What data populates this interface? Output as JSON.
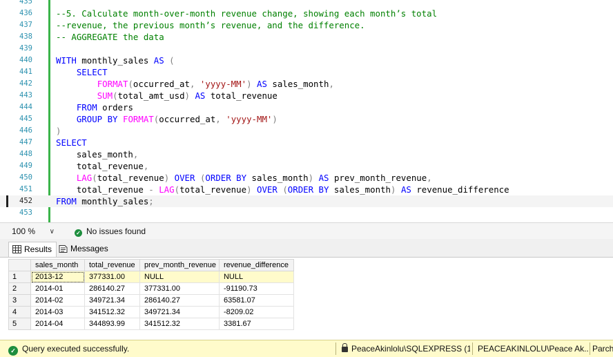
{
  "editor": {
    "lines": [
      {
        "n": "435",
        "tokens": []
      },
      {
        "n": "436",
        "tokens": [
          {
            "t": "c",
            "v": "--5. Calculate month-over-month revenue change, showing each month’s total"
          }
        ]
      },
      {
        "n": "437",
        "tokens": [
          {
            "t": "c",
            "v": "--revenue, the previous month’s revenue, and the difference."
          }
        ]
      },
      {
        "n": "438",
        "tokens": [
          {
            "t": "c",
            "v": "-- AGGREGATE the data"
          }
        ]
      },
      {
        "n": "439",
        "tokens": []
      },
      {
        "n": "440",
        "tokens": [
          {
            "t": "k",
            "v": "WITH"
          },
          {
            "t": "p",
            "v": " monthly_sales "
          },
          {
            "t": "k",
            "v": "AS"
          },
          {
            "t": "o",
            "v": " ("
          }
        ]
      },
      {
        "n": "441",
        "tokens": [
          {
            "t": "p",
            "v": "    "
          },
          {
            "t": "k",
            "v": "SELECT"
          }
        ]
      },
      {
        "n": "442",
        "tokens": [
          {
            "t": "p",
            "v": "        "
          },
          {
            "t": "f",
            "v": "FORMAT"
          },
          {
            "t": "o",
            "v": "("
          },
          {
            "t": "p",
            "v": "occurred_at"
          },
          {
            "t": "o",
            "v": ","
          },
          {
            "t": "p",
            "v": " "
          },
          {
            "t": "s",
            "v": "'yyyy-MM'"
          },
          {
            "t": "o",
            "v": ")"
          },
          {
            "t": "p",
            "v": " "
          },
          {
            "t": "k",
            "v": "AS"
          },
          {
            "t": "p",
            "v": " sales_month"
          },
          {
            "t": "o",
            "v": ","
          }
        ]
      },
      {
        "n": "443",
        "tokens": [
          {
            "t": "p",
            "v": "        "
          },
          {
            "t": "f",
            "v": "SUM"
          },
          {
            "t": "o",
            "v": "("
          },
          {
            "t": "p",
            "v": "total_amt_usd"
          },
          {
            "t": "o",
            "v": ")"
          },
          {
            "t": "p",
            "v": " "
          },
          {
            "t": "k",
            "v": "AS"
          },
          {
            "t": "p",
            "v": " total_revenue"
          }
        ]
      },
      {
        "n": "444",
        "tokens": [
          {
            "t": "p",
            "v": "    "
          },
          {
            "t": "k",
            "v": "FROM"
          },
          {
            "t": "p",
            "v": " orders"
          }
        ]
      },
      {
        "n": "445",
        "tokens": [
          {
            "t": "p",
            "v": "    "
          },
          {
            "t": "k",
            "v": "GROUP BY"
          },
          {
            "t": "p",
            "v": " "
          },
          {
            "t": "f",
            "v": "FORMAT"
          },
          {
            "t": "o",
            "v": "("
          },
          {
            "t": "p",
            "v": "occurred_at"
          },
          {
            "t": "o",
            "v": ","
          },
          {
            "t": "p",
            "v": " "
          },
          {
            "t": "s",
            "v": "'yyyy-MM'"
          },
          {
            "t": "o",
            "v": ")"
          }
        ]
      },
      {
        "n": "446",
        "tokens": [
          {
            "t": "o",
            "v": ")"
          }
        ]
      },
      {
        "n": "447",
        "tokens": [
          {
            "t": "k",
            "v": "SELECT"
          }
        ]
      },
      {
        "n": "448",
        "tokens": [
          {
            "t": "p",
            "v": "    sales_month"
          },
          {
            "t": "o",
            "v": ","
          }
        ]
      },
      {
        "n": "449",
        "tokens": [
          {
            "t": "p",
            "v": "    total_revenue"
          },
          {
            "t": "o",
            "v": ","
          }
        ]
      },
      {
        "n": "450",
        "tokens": [
          {
            "t": "p",
            "v": "    "
          },
          {
            "t": "f",
            "v": "LAG"
          },
          {
            "t": "o",
            "v": "("
          },
          {
            "t": "p",
            "v": "total_revenue"
          },
          {
            "t": "o",
            "v": ")"
          },
          {
            "t": "p",
            "v": " "
          },
          {
            "t": "k",
            "v": "OVER"
          },
          {
            "t": "p",
            "v": " "
          },
          {
            "t": "o",
            "v": "("
          },
          {
            "t": "k",
            "v": "ORDER BY"
          },
          {
            "t": "p",
            "v": " sales_month"
          },
          {
            "t": "o",
            "v": ")"
          },
          {
            "t": "p",
            "v": " "
          },
          {
            "t": "k",
            "v": "AS"
          },
          {
            "t": "p",
            "v": " prev_month_revenue"
          },
          {
            "t": "o",
            "v": ","
          }
        ]
      },
      {
        "n": "451",
        "tokens": [
          {
            "t": "p",
            "v": "    total_revenue "
          },
          {
            "t": "o",
            "v": "-"
          },
          {
            "t": "p",
            "v": " "
          },
          {
            "t": "f",
            "v": "LAG"
          },
          {
            "t": "o",
            "v": "("
          },
          {
            "t": "p",
            "v": "total_revenue"
          },
          {
            "t": "o",
            "v": ")"
          },
          {
            "t": "p",
            "v": " "
          },
          {
            "t": "k",
            "v": "OVER"
          },
          {
            "t": "p",
            "v": " "
          },
          {
            "t": "o",
            "v": "("
          },
          {
            "t": "k",
            "v": "ORDER BY"
          },
          {
            "t": "p",
            "v": " sales_month"
          },
          {
            "t": "o",
            "v": ")"
          },
          {
            "t": "p",
            "v": " "
          },
          {
            "t": "k",
            "v": "AS"
          },
          {
            "t": "p",
            "v": " revenue_difference"
          }
        ]
      },
      {
        "n": "452",
        "current": true,
        "tokens": [
          {
            "t": "k",
            "v": "FROM"
          },
          {
            "t": "p",
            "v": " monthly_sales"
          },
          {
            "t": "o",
            "v": ";"
          }
        ]
      },
      {
        "n": "453",
        "tokens": []
      }
    ]
  },
  "zoombar": {
    "zoom": "100 %",
    "issues": "No issues found"
  },
  "tabs": {
    "results": "Results",
    "messages": "Messages"
  },
  "grid": {
    "columns": [
      "sales_month",
      "total_revenue",
      "prev_month_revenue",
      "revenue_difference"
    ],
    "rows": [
      {
        "num": "1",
        "cells": [
          "2013-12",
          "377331.00",
          "NULL",
          "NULL"
        ],
        "selected": true
      },
      {
        "num": "2",
        "cells": [
          "2014-01",
          "286140.27",
          "377331.00",
          "-91190.73"
        ]
      },
      {
        "num": "3",
        "cells": [
          "2014-02",
          "349721.34",
          "286140.27",
          "63581.07"
        ]
      },
      {
        "num": "4",
        "cells": [
          "2014-03",
          "341512.32",
          "349721.34",
          "-8209.02"
        ]
      },
      {
        "num": "5",
        "cells": [
          "2014-04",
          "344893.99",
          "341512.32",
          "3381.67"
        ]
      }
    ]
  },
  "status": {
    "message": "Query executed successfully.",
    "server": "PeaceAkinlolu\\SQLEXPRESS (1...",
    "user": "PEACEAKINLOLU\\Peace Ak...",
    "extra": "Parch"
  },
  "colors": {
    "keyword": "#0000ff",
    "function": "#ff00ff",
    "string": "#a31515",
    "comment": "#008000",
    "operator": "#808080",
    "status_bg": "#fffbcb"
  },
  "icons": {
    "ok": "check-circle-icon",
    "results_tab": "grid-icon",
    "messages_tab": "message-icon",
    "lock": "lock-icon"
  }
}
